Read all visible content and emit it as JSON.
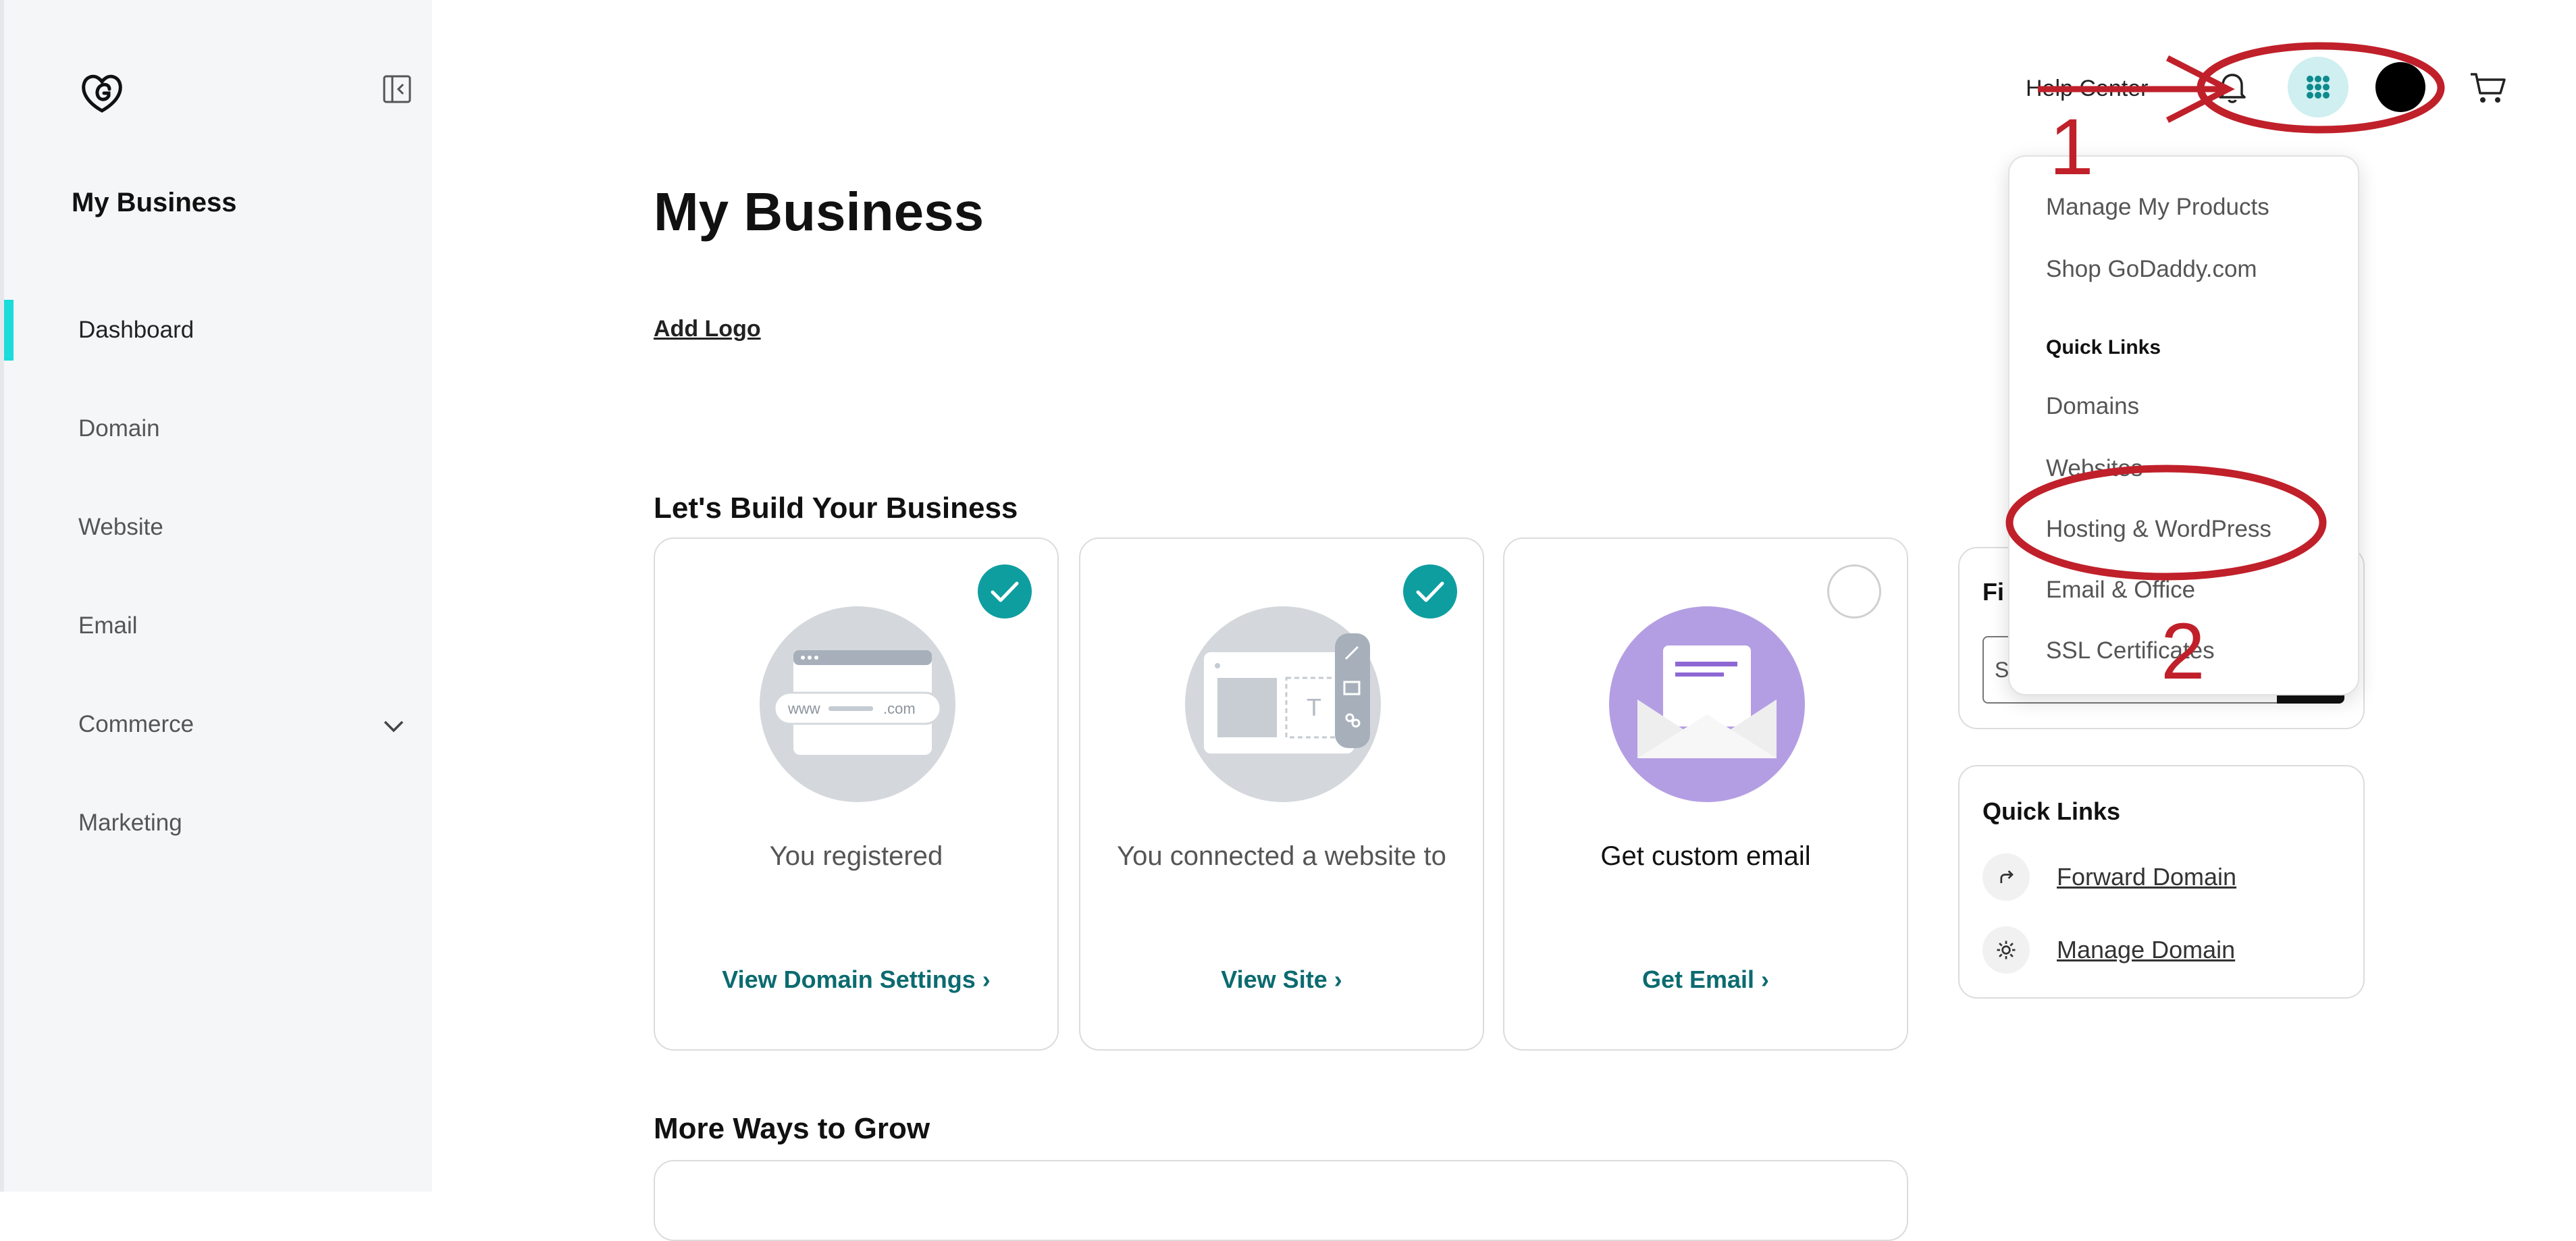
{
  "sidebar": {
    "title": "My Business",
    "items": [
      {
        "label": "Dashboard",
        "active": true
      },
      {
        "label": "Domain"
      },
      {
        "label": "Website"
      },
      {
        "label": "Email"
      },
      {
        "label": "Commerce",
        "expandable": true
      },
      {
        "label": "Marketing"
      }
    ]
  },
  "topbar": {
    "help_label": "Help Center"
  },
  "main": {
    "title": "My Business",
    "add_logo": "Add Logo",
    "build_title": "Let's Build Your Business",
    "cards": [
      {
        "text": "You registered",
        "link": "View Domain Settings ›",
        "completed": true
      },
      {
        "text": "You connected a website to",
        "link": "View Site ›",
        "completed": true
      },
      {
        "text": "Get custom email",
        "link": "Get Email ›",
        "completed": false
      }
    ],
    "more_title": "More Ways to Grow"
  },
  "find_card": {
    "title": "Fi",
    "input_placeholder": "S"
  },
  "quick_links_card": {
    "title": "Quick Links",
    "items": [
      {
        "label": "Forward Domain",
        "icon": "forward-arrow-icon"
      },
      {
        "label": "Manage Domain",
        "icon": "gear-icon"
      }
    ]
  },
  "dropdown": {
    "items": [
      "Manage My Products",
      "Shop GoDaddy.com"
    ],
    "header": "Quick Links",
    "links": [
      "Domains",
      "Websites",
      "Hosting & WordPress",
      "Email & Office",
      "SSL Certificates"
    ]
  },
  "annotations": {
    "step1": "1",
    "step2": "2"
  },
  "colors": {
    "accent": "#0e9ea0",
    "link": "#0b6b70",
    "active_bar": "#1bdbdb",
    "annotation": "#c0202a",
    "email_illustration": "#b49ee3"
  }
}
